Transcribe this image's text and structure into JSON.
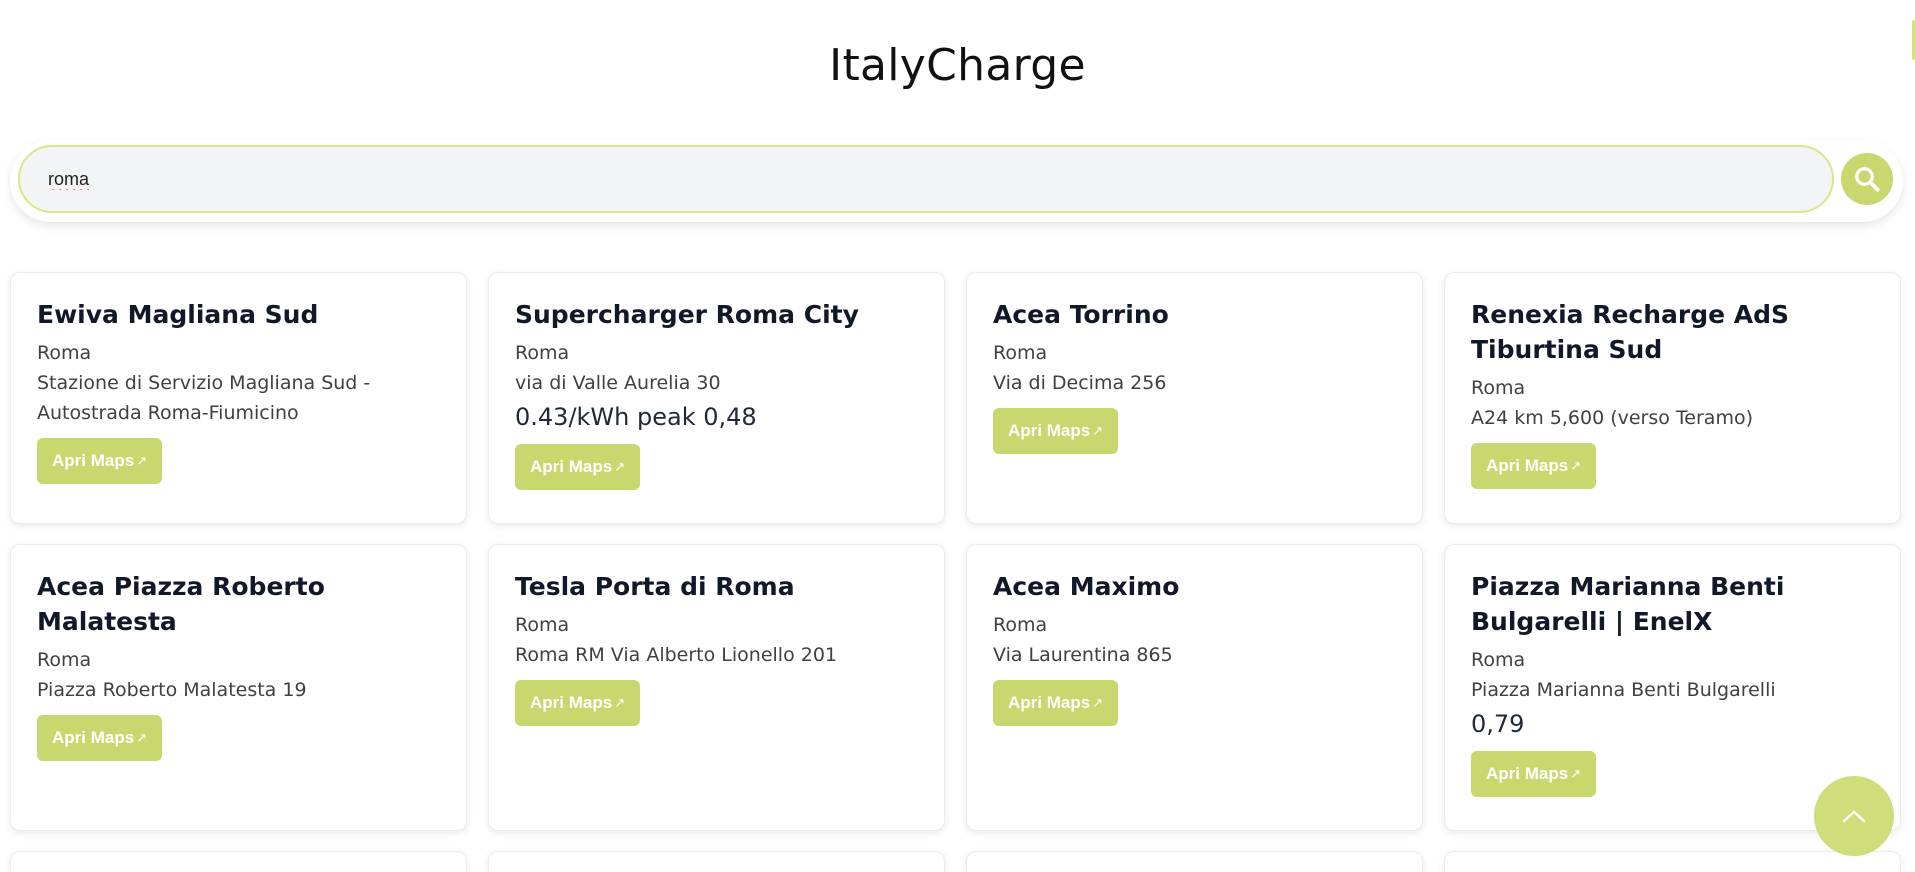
{
  "app": {
    "title": "ItalyCharge"
  },
  "search": {
    "value": "roma"
  },
  "stations": [
    {
      "name": "Ewiva Magliana Sud",
      "city": "Roma",
      "address": "Stazione di Servizio Magliana Sud - Autostrada Roma-Fiumicino",
      "price": "",
      "button": "Apri Maps"
    },
    {
      "name": "Supercharger Roma City",
      "city": "Roma",
      "address": "via di Valle Aurelia 30",
      "price": "0.43/kWh peak 0,48",
      "button": "Apri Maps"
    },
    {
      "name": "Acea Torrino",
      "city": "Roma",
      "address": "Via di Decima 256",
      "price": "",
      "button": "Apri Maps"
    },
    {
      "name": "Renexia Recharge AdS Tiburtina Sud",
      "city": "Roma",
      "address": "A24 km 5,600 (verso Teramo)",
      "price": "",
      "button": "Apri Maps"
    },
    {
      "name": "Acea Piazza Roberto Malatesta",
      "city": "Roma",
      "address": "Piazza Roberto Malatesta 19",
      "price": "",
      "button": "Apri Maps"
    },
    {
      "name": "Tesla Porta di Roma",
      "city": "Roma",
      "address": "Roma RM Via Alberto Lionello 201",
      "price": "",
      "button": "Apri Maps"
    },
    {
      "name": "Acea Maximo",
      "city": "Roma",
      "address": "Via Laurentina 865",
      "price": "",
      "button": "Apri Maps"
    },
    {
      "name": "Piazza Marianna Benti Bulgarelli | EnelX",
      "city": "Roma",
      "address": "Piazza Marianna Benti Bulgarelli",
      "price": "0,79",
      "button": "Apri Maps"
    }
  ],
  "icons": {
    "search": "search-icon",
    "external": "external-link-icon",
    "scroll_top": "chevron-up-icon"
  },
  "colors": {
    "accent": "#c9d86e",
    "input_border": "#dbe68b",
    "input_bg": "#f3f4f6"
  }
}
